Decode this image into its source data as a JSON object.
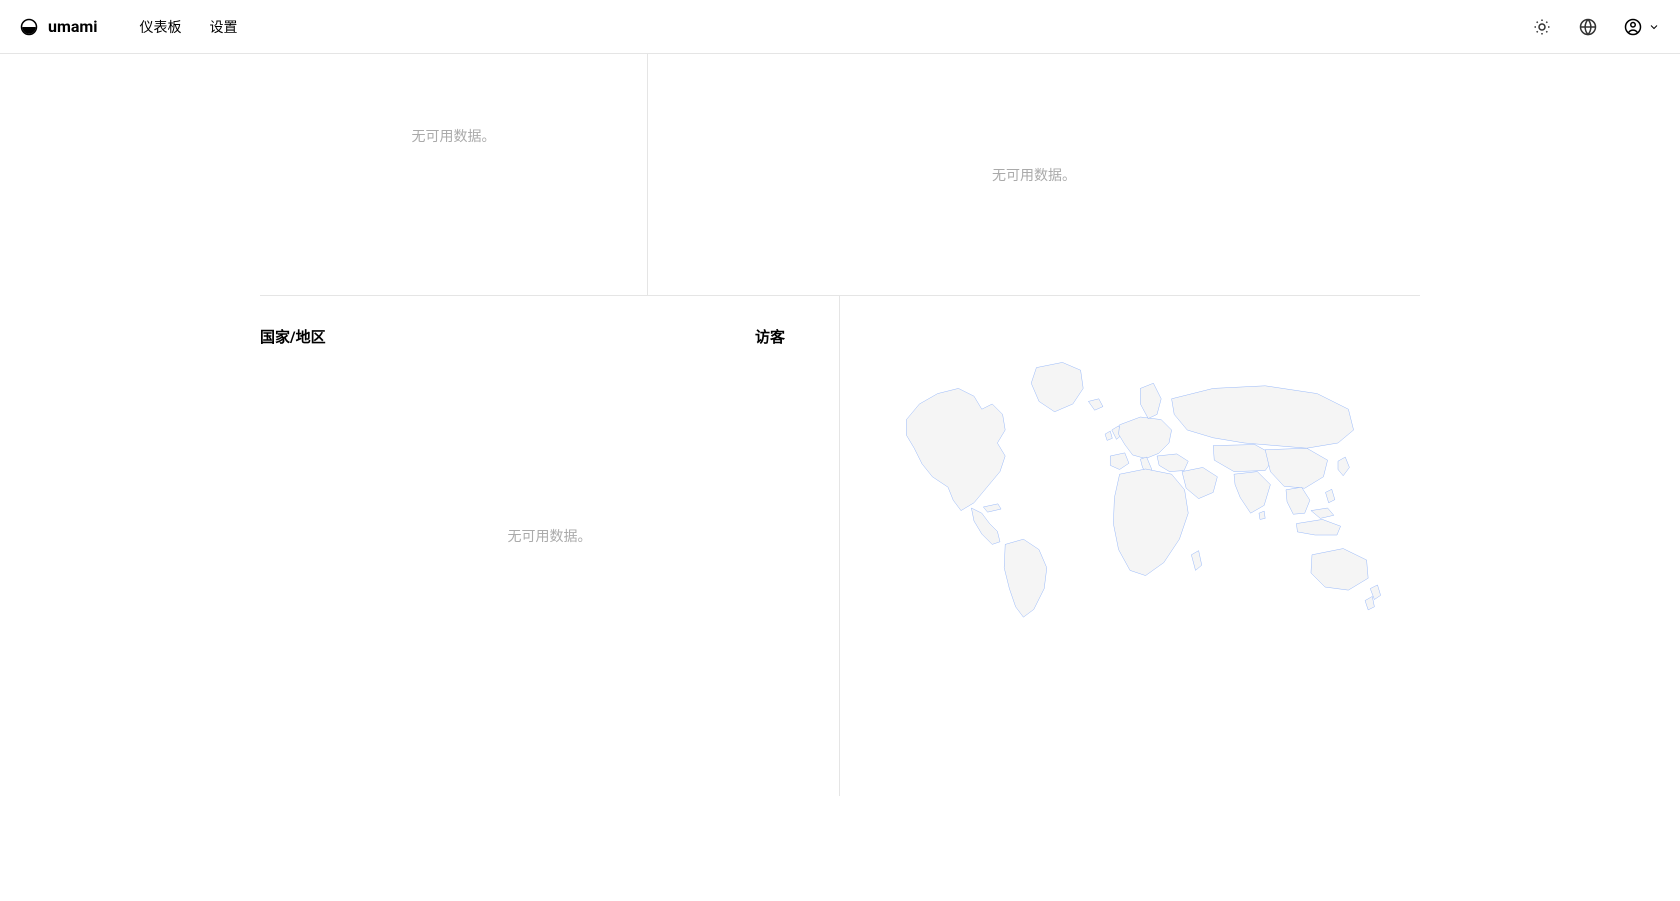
{
  "header": {
    "brand": "umami",
    "nav": {
      "dashboard": "仪表板",
      "settings": "设置"
    }
  },
  "panels": {
    "top_left_no_data": "无可用数据。",
    "top_right_no_data": "无可用数据。",
    "countries": {
      "title": "国家/地区",
      "sub": "访客",
      "no_data": "无可用数据。"
    }
  },
  "chart_data": {
    "type": "table",
    "title": "国家/地区",
    "columns": [
      "国家/地区",
      "访客"
    ],
    "rows": [],
    "note": "无可用数据。"
  }
}
